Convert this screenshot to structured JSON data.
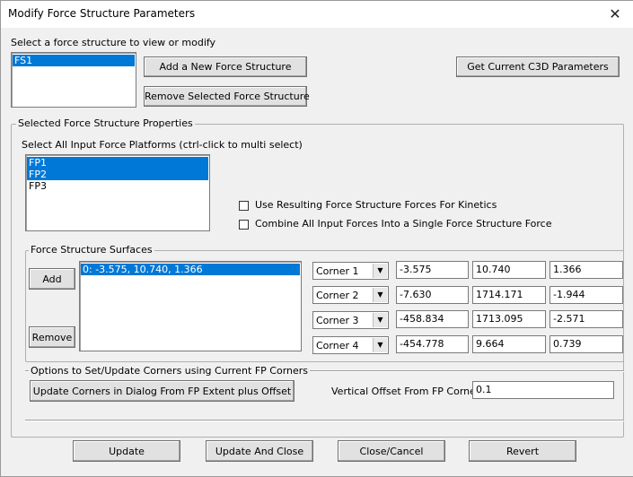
{
  "window": {
    "title": "Modify Force Structure Parameters",
    "close_glyph": "✕"
  },
  "structure": {
    "prompt": "Select a force structure to view or modify",
    "items": [
      "FS1"
    ],
    "add_button": "Add a New Force Structure",
    "remove_button": "Remove Selected Force Structure",
    "get_params_button": "Get Current C3D Parameters"
  },
  "properties": {
    "group_label": "Selected Force Structure Properties",
    "platforms_prompt": "Select All Input Force Platforms (ctrl-click to multi select)",
    "platforms": [
      "FP1",
      "FP2",
      "FP3"
    ],
    "use_resulting_label": "Use Resulting Force Structure Forces For Kinetics",
    "combine_label": "Combine All Input Forces Into a Single Force Structure Force"
  },
  "surfaces": {
    "group_label": "Force Structure Surfaces",
    "add_button": "Add",
    "remove_button": "Remove",
    "items": [
      "0: -3.575, 10.740, 1.366"
    ],
    "corners": [
      {
        "label": "Corner 1",
        "x": "-3.575",
        "y": "10.740",
        "z": "1.366"
      },
      {
        "label": "Corner 2",
        "x": "-7.630",
        "y": "1714.171",
        "z": "-1.944"
      },
      {
        "label": "Corner 3",
        "x": "-458.834",
        "y": "1713.095",
        "z": "-2.571"
      },
      {
        "label": "Corner 4",
        "x": "-454.778",
        "y": "9.664",
        "z": "0.739"
      }
    ]
  },
  "options": {
    "group_label": "Options to Set/Update Corners using Current FP Corners",
    "update_corners_button": "Update Corners in Dialog From FP Extent plus Offset",
    "offset_label": "Vertical Offset From FP Corners",
    "offset_value": "0.1"
  },
  "footer": {
    "update": "Update",
    "update_close": "Update And Close",
    "close_cancel": "Close/Cancel",
    "revert": "Revert"
  }
}
